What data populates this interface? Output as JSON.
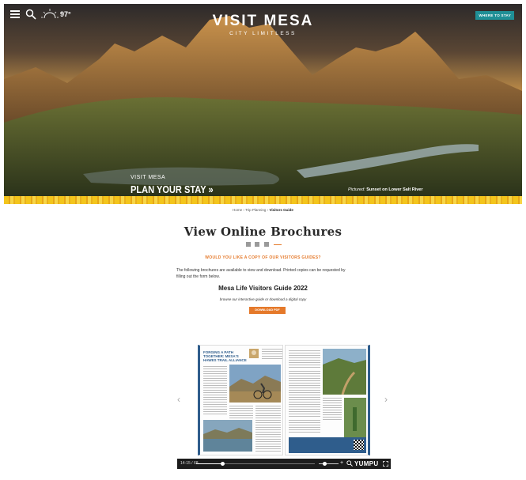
{
  "header": {
    "temperature": "97°",
    "brand": "VISIT MESA",
    "tagline": "CITY LIMITLESS",
    "where_button": "WHERE TO STAY"
  },
  "hero": {
    "kicker": "VISIT MESA",
    "cta": "PLAN YOUR STAY »",
    "caption_prefix": "Pictured:",
    "caption_text": "Sunset on Lower Salt River"
  },
  "breadcrumb": {
    "home": "Home",
    "sep1": "›",
    "parent": "Trip Planning",
    "sep2": "›",
    "current": "Visitors Guide"
  },
  "main": {
    "title": "View Online Brochures",
    "copy_question": "WOULD YOU LIKE A COPY OF OUR VISITORS GUIDES?",
    "description": "The following brochures are available to view and download. Printed copies can be requested by filling out the form below.",
    "guide_title": "Mesa Life Visitors Guide 2022",
    "guide_subtitle": "browse our interactive guide or download a digital copy",
    "download_label": "DOWNLOAD PDF"
  },
  "flipbook": {
    "left_page_title": "FORGING A PATH TOGETHER: MESA'S HAWES TRAIL ALLIANCE",
    "page_indicator": "14-15 / 68",
    "progress": 0.22,
    "zoom": 0.3,
    "brand": "YUMPU"
  },
  "colors": {
    "accent_orange": "#e5792a",
    "teal_button": "#1f8f96",
    "pattern_yellow": "#f3c51c",
    "page_blue": "#2f5d8c"
  }
}
